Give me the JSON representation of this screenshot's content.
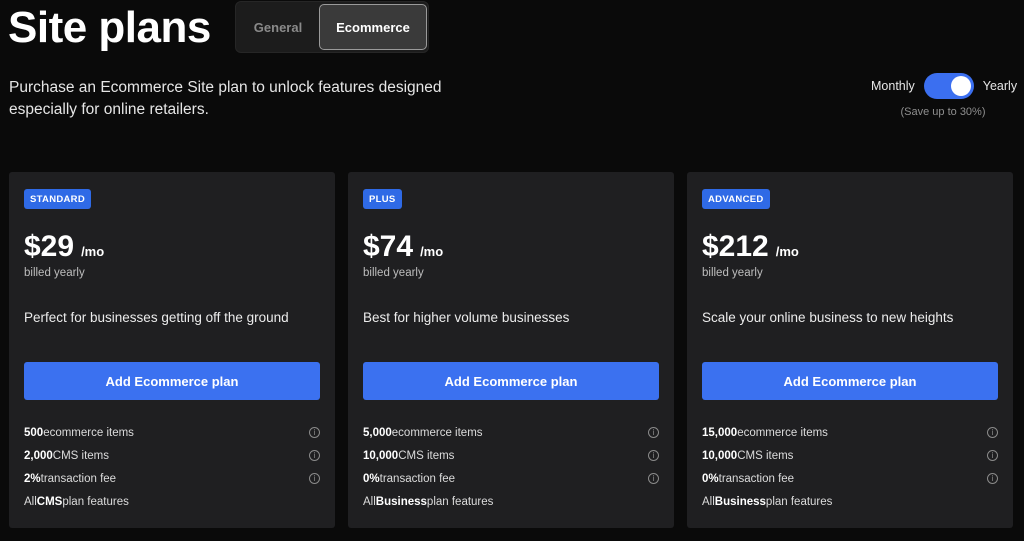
{
  "header": {
    "title": "Site plans",
    "tabs": [
      {
        "label": "General",
        "selected": false
      },
      {
        "label": "Ecommerce",
        "selected": true
      }
    ],
    "subtitle": "Purchase an Ecommerce Site plan to unlock features designed especially for online retailers."
  },
  "billing": {
    "monthly_label": "Monthly",
    "yearly_label": "Yearly",
    "selected": "Yearly",
    "save_note": "(Save up to 30%)"
  },
  "colors": {
    "accent": "#3b71f0",
    "badge": "#2f6ae6",
    "card_bg": "#1f1f21",
    "page_bg": "#0a0a0a"
  },
  "plans": [
    {
      "badge": "STANDARD",
      "price": "$29",
      "per": "/mo",
      "billed": "billed yearly",
      "description": "Perfect for businesses getting off the ground",
      "cta": "Add Ecommerce plan",
      "features": [
        {
          "bold": "500",
          "text": " ecommerce items",
          "info_icon": "info-icon"
        },
        {
          "bold": "2,000",
          "text": " CMS items",
          "info_icon": "info-icon"
        },
        {
          "bold": "2%",
          "text": " transaction fee",
          "info_icon": "info-icon"
        },
        {
          "prefix": "All ",
          "bold": "CMS",
          "text": " plan features"
        }
      ]
    },
    {
      "badge": "PLUS",
      "price": "$74",
      "per": "/mo",
      "billed": "billed yearly",
      "description": "Best for higher volume businesses",
      "cta": "Add Ecommerce plan",
      "features": [
        {
          "bold": "5,000",
          "text": " ecommerce items",
          "info_icon": "info-icon"
        },
        {
          "bold": "10,000",
          "text": " CMS items",
          "info_icon": "info-icon"
        },
        {
          "bold": "0%",
          "text": " transaction fee",
          "info_icon": "info-icon"
        },
        {
          "prefix": "All ",
          "bold": "Business",
          "text": " plan features"
        }
      ]
    },
    {
      "badge": "ADVANCED",
      "price": "$212",
      "per": "/mo",
      "billed": "billed yearly",
      "description": "Scale your online business to new heights",
      "cta": "Add Ecommerce plan",
      "features": [
        {
          "bold": "15,000",
          "text": " ecommerce items",
          "info_icon": "info-icon"
        },
        {
          "bold": "10,000",
          "text": " CMS items",
          "info_icon": "info-icon"
        },
        {
          "bold": "0%",
          "text": " transaction fee",
          "info_icon": "info-icon"
        },
        {
          "prefix": "All ",
          "bold": "Business",
          "text": " plan features"
        }
      ]
    }
  ]
}
